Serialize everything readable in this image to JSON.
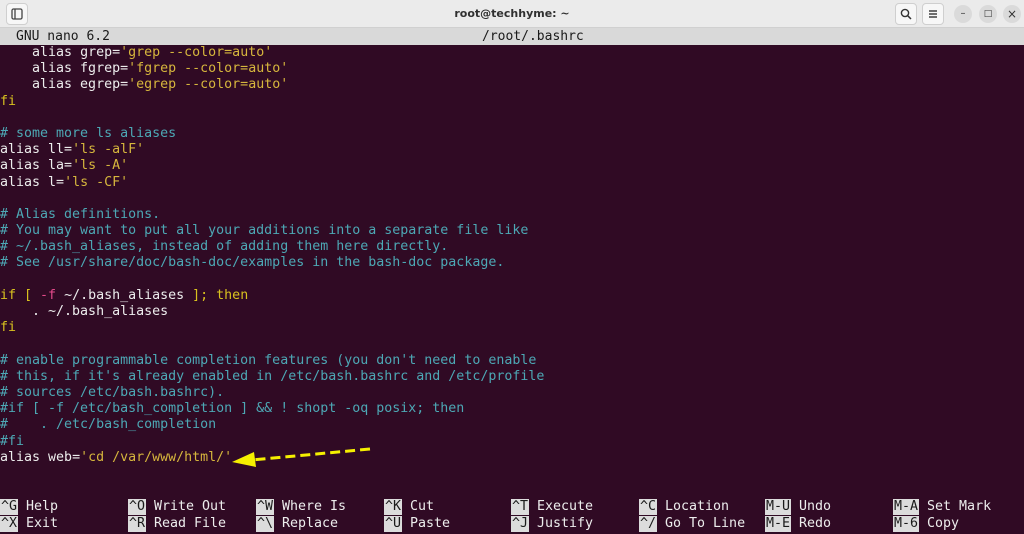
{
  "window": {
    "title": "root@techhyme: ~",
    "buttons": [
      "new-tab-icon",
      "search-icon",
      "menu-icon",
      "minimize-icon",
      "maximize-icon",
      "close-icon"
    ],
    "minimize_glyph": "–",
    "maximize_glyph": "□",
    "close_glyph": "×"
  },
  "nano": {
    "version": "GNU nano 6.2",
    "filename": "/root/.bashrc"
  },
  "lines": [
    [
      {
        "t": "    alias ",
        "c": "plain"
      },
      {
        "t": "grep",
        "c": "plain"
      },
      {
        "t": "=",
        "c": "plain"
      },
      {
        "t": "'grep --color=auto'",
        "c": "str"
      }
    ],
    [
      {
        "t": "    alias fgrep",
        "c": "plain"
      },
      {
        "t": "=",
        "c": "plain"
      },
      {
        "t": "'fgrep --color=auto'",
        "c": "str"
      }
    ],
    [
      {
        "t": "    alias egrep",
        "c": "plain"
      },
      {
        "t": "=",
        "c": "plain"
      },
      {
        "t": "'egrep --color=auto'",
        "c": "str"
      }
    ],
    [
      {
        "t": "fi",
        "c": "kw"
      }
    ],
    [
      {
        "t": "",
        "c": "plain"
      }
    ],
    [
      {
        "t": "# some more ls aliases",
        "c": "cm"
      }
    ],
    [
      {
        "t": "alias ll",
        "c": "plain"
      },
      {
        "t": "=",
        "c": "plain"
      },
      {
        "t": "'ls -alF'",
        "c": "str"
      }
    ],
    [
      {
        "t": "alias la",
        "c": "plain"
      },
      {
        "t": "=",
        "c": "plain"
      },
      {
        "t": "'ls -A'",
        "c": "str"
      }
    ],
    [
      {
        "t": "alias l",
        "c": "plain"
      },
      {
        "t": "=",
        "c": "plain"
      },
      {
        "t": "'ls -CF'",
        "c": "str"
      }
    ],
    [
      {
        "t": "",
        "c": "plain"
      }
    ],
    [
      {
        "t": "# Alias definitions.",
        "c": "cm"
      }
    ],
    [
      {
        "t": "# You may want to put all your additions into a separate file like",
        "c": "cm"
      }
    ],
    [
      {
        "t": "# ~/.bash_aliases, instead of adding them here directly.",
        "c": "cm"
      }
    ],
    [
      {
        "t": "# See /usr/share/doc/bash-doc/examples in the bash-doc package.",
        "c": "cm"
      }
    ],
    [
      {
        "t": "",
        "c": "plain"
      }
    ],
    [
      {
        "t": "if",
        "c": "kw"
      },
      {
        "t": " [ ",
        "c": "kw"
      },
      {
        "t": "-f",
        "c": "op"
      },
      {
        "t": " ~/.bash_aliases ",
        "c": "plain"
      },
      {
        "t": "]; then",
        "c": "kw"
      }
    ],
    [
      {
        "t": "    . ~/.bash_aliases",
        "c": "plain"
      }
    ],
    [
      {
        "t": "fi",
        "c": "kw"
      }
    ],
    [
      {
        "t": "",
        "c": "plain"
      }
    ],
    [
      {
        "t": "# enable programmable completion features (you don't need to enable",
        "c": "cm"
      }
    ],
    [
      {
        "t": "# this, if it's already enabled in /etc/bash.bashrc and /etc/profile",
        "c": "cm"
      }
    ],
    [
      {
        "t": "# sources /etc/bash.bashrc).",
        "c": "cm"
      }
    ],
    [
      {
        "t": "#if [ -f /etc/bash_completion ] && ! shopt -oq posix; then",
        "c": "cm"
      }
    ],
    [
      {
        "t": "#    . /etc/bash_completion",
        "c": "cm"
      }
    ],
    [
      {
        "t": "#fi",
        "c": "cm"
      }
    ],
    [
      {
        "t": "alias web",
        "c": "plain"
      },
      {
        "t": "=",
        "c": "plain"
      },
      {
        "t": "'cd /var/www/html/'",
        "c": "str"
      }
    ]
  ],
  "shortcuts": [
    {
      "key": "^G",
      "label": "Help"
    },
    {
      "key": "^X",
      "label": "Exit"
    },
    {
      "key": "^O",
      "label": "Write Out"
    },
    {
      "key": "^R",
      "label": "Read File"
    },
    {
      "key": "^W",
      "label": "Where Is"
    },
    {
      "key": "^\\",
      "label": "Replace"
    },
    {
      "key": "^K",
      "label": "Cut"
    },
    {
      "key": "^U",
      "label": "Paste"
    },
    {
      "key": "^T",
      "label": "Execute"
    },
    {
      "key": "^J",
      "label": "Justify"
    },
    {
      "key": "^C",
      "label": "Location"
    },
    {
      "key": "^/",
      "label": "Go To Line"
    },
    {
      "key": "M-U",
      "label": "Undo"
    },
    {
      "key": "M-E",
      "label": "Redo"
    },
    {
      "key": "M-A",
      "label": "Set Mark"
    },
    {
      "key": "M-6",
      "label": "Copy"
    }
  ],
  "colors": {
    "background": "#300a24",
    "comment": "#4da8b5",
    "string": "#d6b63d",
    "keyword": "#d8c11f",
    "annotation_arrow": "#f5f000"
  }
}
